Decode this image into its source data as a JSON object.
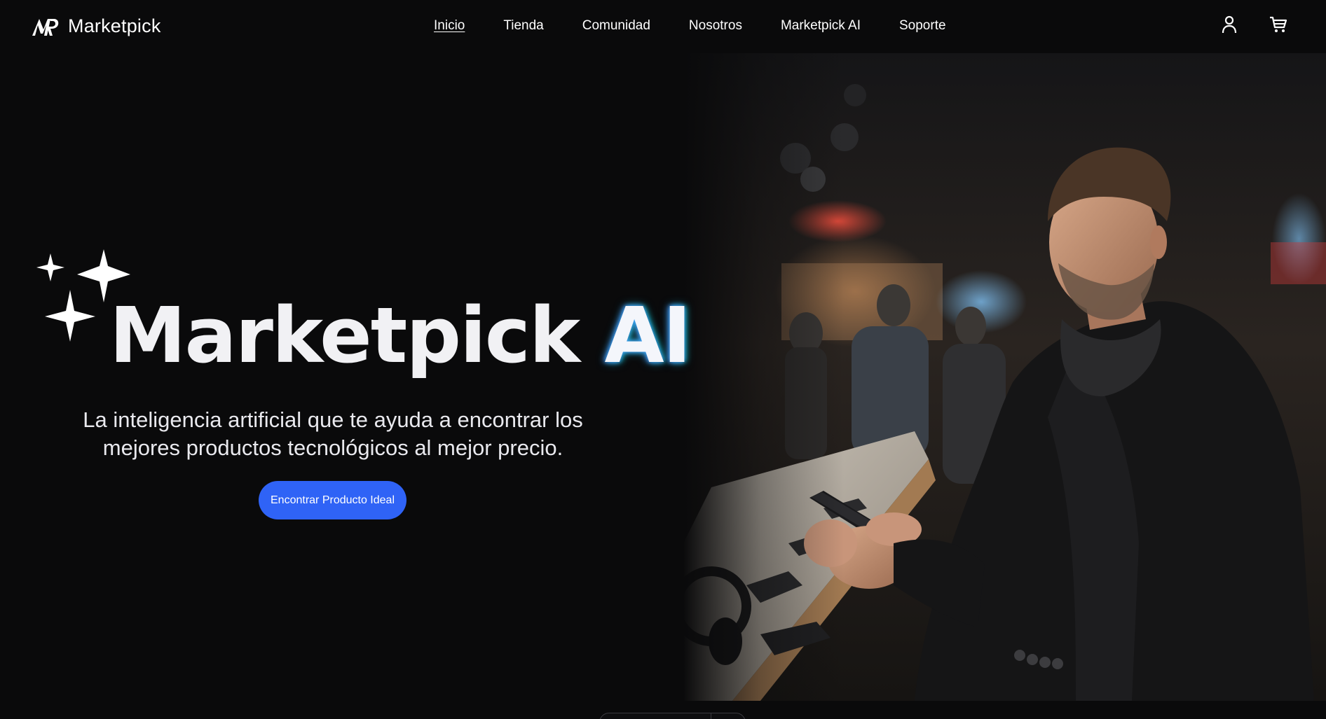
{
  "brand": {
    "name": "Marketpick",
    "logo_icon": "marketpick-logo-icon"
  },
  "nav": {
    "items": [
      {
        "label": "Inicio",
        "active": true
      },
      {
        "label": "Tienda",
        "active": false
      },
      {
        "label": "Comunidad",
        "active": false
      },
      {
        "label": "Nosotros",
        "active": false
      },
      {
        "label": "Marketpick AI",
        "active": false
      },
      {
        "label": "Soporte",
        "active": false
      }
    ]
  },
  "header_actions": {
    "account_icon": "user-icon",
    "cart_icon": "cart-icon"
  },
  "hero": {
    "title_brand": "Marketpick",
    "title_ai": "AI",
    "subtitle_line1": "La inteligencia artificial que te ayuda a encontrar los",
    "subtitle_line2": "mejores productos tecnológicos al mejor precio.",
    "cta_label": "Encontrar Producto Ideal",
    "decoration_icon": "sparkles-icon"
  },
  "colors": {
    "background": "#0a0a0b",
    "accent": "#2f63f6",
    "text": "#ffffff"
  }
}
